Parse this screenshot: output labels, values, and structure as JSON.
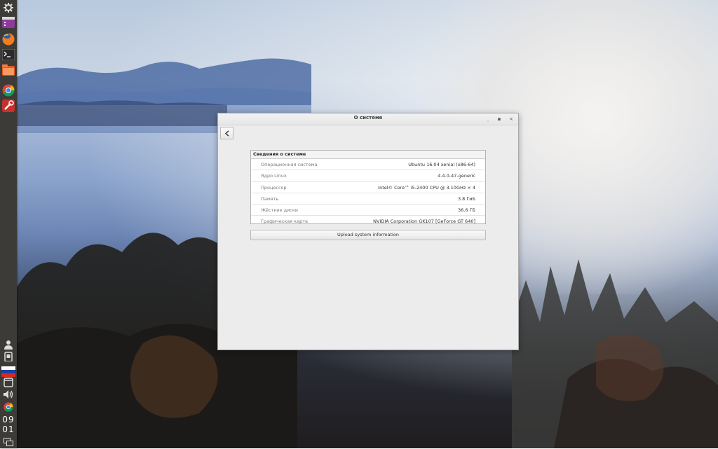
{
  "window": {
    "title": "О системе",
    "minimize_glyph": "˯",
    "maximize_glyph": "▪",
    "close_glyph": "×"
  },
  "info": {
    "header": "Сведения о системе",
    "rows": [
      {
        "label": "Операционная система",
        "value": "Ubuntu 16.04 xenial (x86-64)"
      },
      {
        "label": "Ядро Linux",
        "value": "4.4.0-47-generic"
      },
      {
        "label": "Процессор",
        "value": "Intel© Core™ i5-2400 CPU @ 3.10GHz × 4"
      },
      {
        "label": "Память",
        "value": "3.8 ГиБ"
      },
      {
        "label": "Жёсткие диски",
        "value": "36.6 ГБ"
      },
      {
        "label": "Графическая карта",
        "value": "NVIDIA Corporation GK107 [GeForce GT 640]"
      }
    ],
    "upload_label": "Upload system information"
  },
  "dock": {
    "icons": [
      "gear-icon",
      "app-launcher-icon",
      "firefox-icon",
      "terminal-icon",
      "files-icon",
      "chrome-icon",
      "tweak-tool-icon"
    ],
    "tray": [
      "user-icon",
      "clipboard-icon",
      "russian-flag-icon",
      "window-icon",
      "volume-icon",
      "chrome-tray-icon",
      "workspace-icon"
    ],
    "clock_hours": "09",
    "clock_minutes": "01"
  }
}
